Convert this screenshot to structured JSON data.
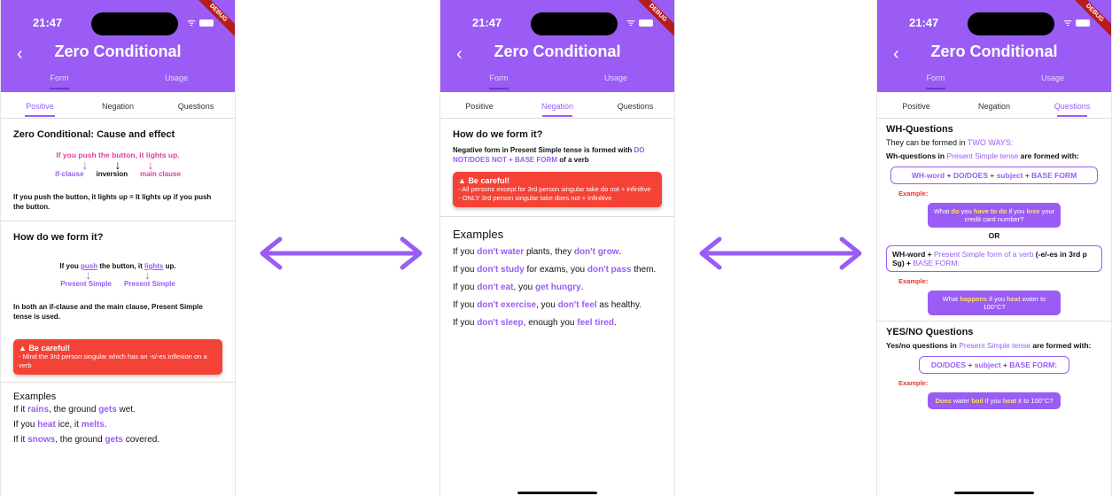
{
  "status": {
    "time": "21:47",
    "debug": "DEBUG"
  },
  "appbar": {
    "title": "Zero Conditional",
    "back_icon": "‹"
  },
  "top_tabs": [
    "Form",
    "Usage"
  ],
  "sub_tabs": [
    "Positive",
    "Negation",
    "Questions"
  ],
  "screen1": {
    "heading1": "Zero Conditional: Cause and effect",
    "diagram1": {
      "sentence": "If you push the button, it lights up.",
      "left": "if-clause",
      "mid": "inversion",
      "right": "main clause"
    },
    "equivalence": "If you push the button, it lights up = It lights up if you push the button.",
    "heading2": "How do we form it?",
    "diagram2": {
      "sentence_a": "If you",
      "push": "push",
      "sentence_b": "the button, it",
      "lights": "lights",
      "sentence_c": "up.",
      "left": "Present Simple",
      "right": "Present Simple"
    },
    "note": "In both an if-clause and the main clause, Present Simple tense is used.",
    "warn_title": "Be careful!",
    "warn_text": "- Mind the 3rd person singular which has an -s/-es inflexion on a verb",
    "examples_heading": "Examples",
    "examples": [
      {
        "a": "If it ",
        "b": "rains",
        "c": ", the ground ",
        "d": "gets",
        "e": " wet."
      },
      {
        "a": "If you ",
        "b": "heat",
        "c": " ice, it ",
        "d": "melts",
        "e": "."
      },
      {
        "a": "If it ",
        "b": "snows",
        "c": ", the ground ",
        "d": "gets",
        "e": " covered."
      }
    ]
  },
  "screen2": {
    "heading": "How do we form it?",
    "rule_a": "Negative form in Present Simple tense is formed with",
    "rule_b": "DO NOT/DOES NOT + BASE FORM",
    "rule_c": " of a verb",
    "warn_title": "Be careful!",
    "warn_l1": "- All persons except for 3rd person singular take do not + infinitive",
    "warn_l2": "- ONLY 3rd person singular take does not + infinitive",
    "examples_heading": "Examples",
    "examples": [
      {
        "a": "If you ",
        "b": "don't water",
        "c": " plants, they ",
        "d": "don't grow",
        "e": "."
      },
      {
        "a": "If you ",
        "b": "don't study",
        "c": " for exams, you ",
        "d": "don't pass",
        "e": " them."
      },
      {
        "a": "If you ",
        "b": "don't eat",
        "c": ", you ",
        "d": "get hungry",
        "e": "."
      },
      {
        "a": "If you ",
        "b": "don't exercise",
        "c": ", you ",
        "d": "don't feel",
        "e": " as healthy."
      },
      {
        "a": "If you ",
        "b": "don't sleep",
        "c": ", enough you ",
        "d": "feel tired",
        "e": "."
      }
    ]
  },
  "screen3": {
    "wh_heading": "WH-Questions",
    "ways_a": "They can be formed in ",
    "ways_b": "TWO WAYS:",
    "wh_rule_a": "Wh-questions in ",
    "wh_rule_b": "Present Simple tense",
    "wh_rule_c": " are formed with:",
    "pill1": {
      "a": "WH-word",
      "b": " + ",
      "c": "DO/DOES",
      "d": " + ",
      "e": "subject",
      "f": " + ",
      "g": "BASE FORM"
    },
    "example_label": "Example:",
    "bubble1": {
      "a": "What ",
      "b": "do",
      "c": " you ",
      "d": "have to do",
      "e": " if you ",
      "f": "lose",
      "g": " your credit card number?"
    },
    "or": "OR",
    "pill2": {
      "a": "WH-word + ",
      "b": "Present Simple form of a verb",
      "c": " (-e/-es in 3rd p Sg) + ",
      "d": "BASE FORM:"
    },
    "bubble2": {
      "a": "What ",
      "b": "happens",
      "c": " if you ",
      "d": "heat",
      "e": " water to 100°C?"
    },
    "yn_heading": "YES/NO Questions",
    "yn_rule_a": "Yes/no questions in ",
    "yn_rule_b": "Present Simple tense",
    "yn_rule_c": " are formed with:",
    "pill3": {
      "a": "DO/DOES",
      "b": " + ",
      "c": "subject",
      "d": " + ",
      "e": "BASE FORM:"
    },
    "bubble3": {
      "a": "Does",
      "b": " water ",
      "c": "boil",
      "d": " if you ",
      "e": "heat",
      "f": " it to 100°C?"
    }
  },
  "colors": {
    "primary": "#9a5cf4",
    "warning": "#f44336",
    "pink": "#e13ea4"
  }
}
